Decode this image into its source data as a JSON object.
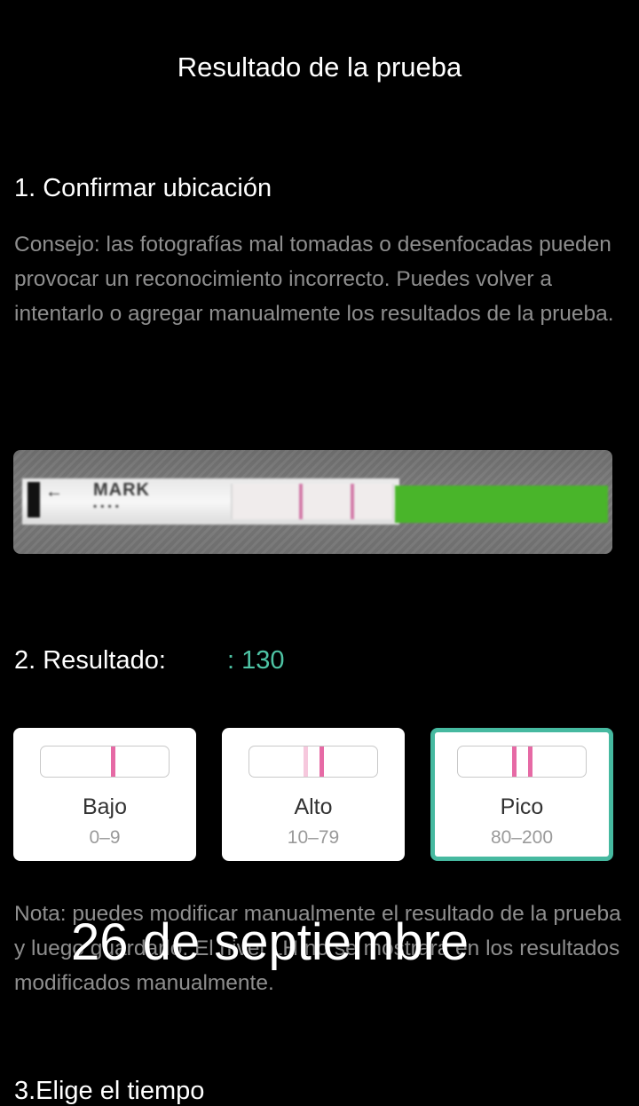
{
  "header": {
    "title": "Resultado de la prueba"
  },
  "section1": {
    "heading": "1. Confirmar ubicación",
    "tip": "Consejo: las fotografías mal tomadas o desenfocadas pueden provocar un reconocimiento incorrecto. Puedes volver a intentarlo o agregar manualmente los resultados de la prueba.",
    "photo_text": "MARK"
  },
  "section2": {
    "label": "2. Resultado:",
    "value": ": 130",
    "value_color": "#4ec3a4",
    "options": [
      {
        "name": "Bajo",
        "range": "0–9",
        "selected": false
      },
      {
        "name": "Alto",
        "range": "10–79",
        "selected": false
      },
      {
        "name": "Pico",
        "range": "80–200",
        "selected": true
      }
    ],
    "selected_border_color": "#46b9a0",
    "line_color": "#e66aa5"
  },
  "note": "Nota: puedes modificar manualmente el resultado de la prueba y luego guardarlo. El nivel LH no se mostrará en los resultados modificados manualmente.",
  "overlay_date": "26 de septiembre",
  "section3": {
    "heading": "3.Elige el tiempo"
  }
}
